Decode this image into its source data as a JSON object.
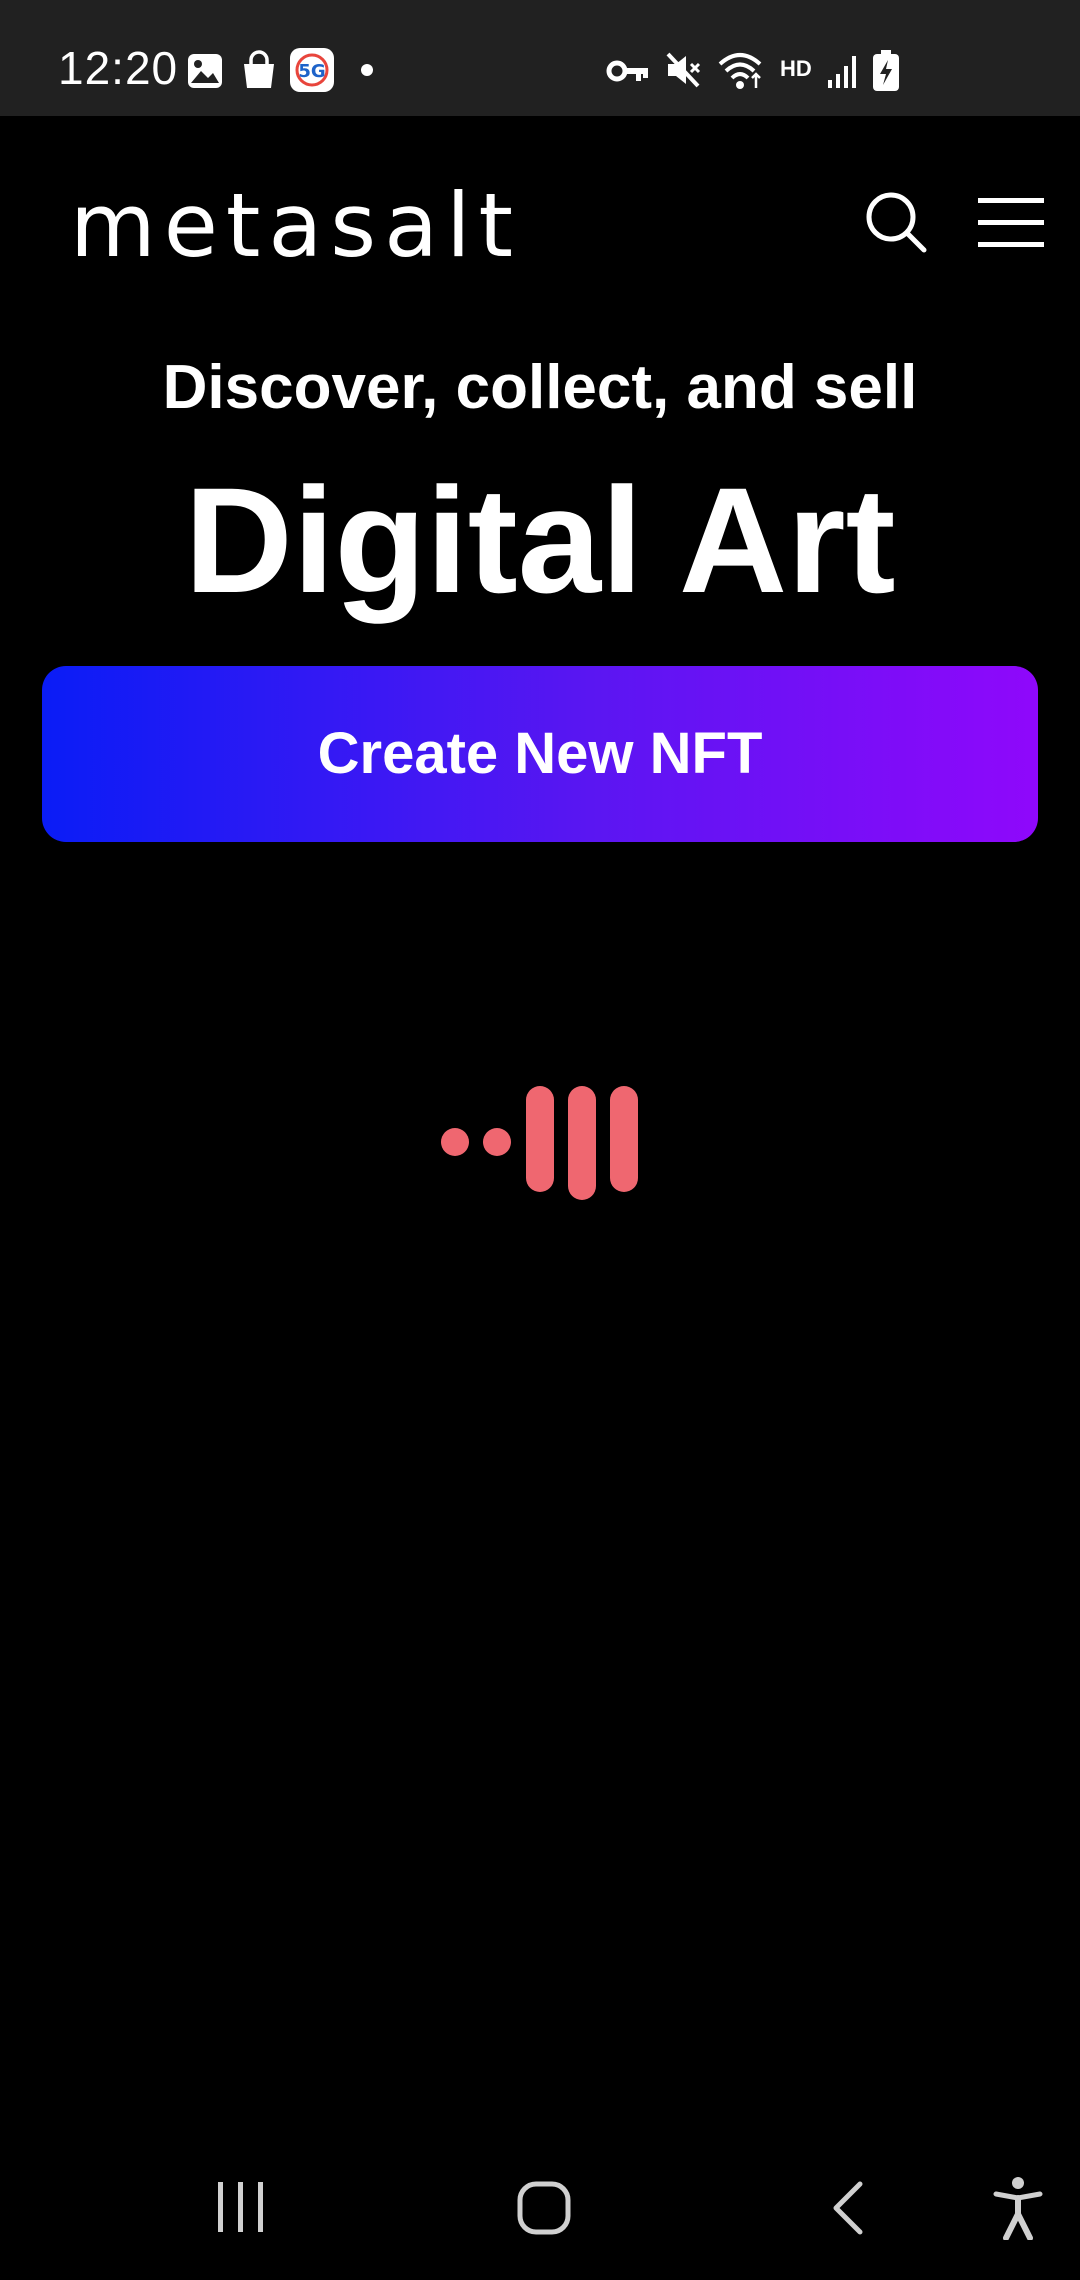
{
  "status_bar": {
    "time": "12:20",
    "network_label": "HD",
    "icons": [
      "gallery-icon",
      "shopping-bag-icon",
      "5g-app-icon",
      "notification-dot-icon",
      "vpn-key-icon",
      "mute-icon",
      "wifi-icon",
      "hd-icon",
      "signal-icon",
      "battery-charging-icon"
    ]
  },
  "header": {
    "logo": "metasalt",
    "icons": [
      "search-icon",
      "menu-icon"
    ]
  },
  "hero": {
    "subtitle": "Discover, collect, and sell",
    "title": "Digital Art"
  },
  "cta": {
    "label": "Create New NFT"
  },
  "loader": {
    "icon": "loading-spinner-icon",
    "color": "#ef6770"
  },
  "colors": {
    "background": "#000000",
    "status_bar": "#212121",
    "gradient_start": "#0a1cf6",
    "gradient_end": "#8f08fb"
  },
  "nav_bar": {
    "icons": [
      "recent-apps-icon",
      "home-icon",
      "back-icon",
      "accessibility-icon"
    ]
  }
}
